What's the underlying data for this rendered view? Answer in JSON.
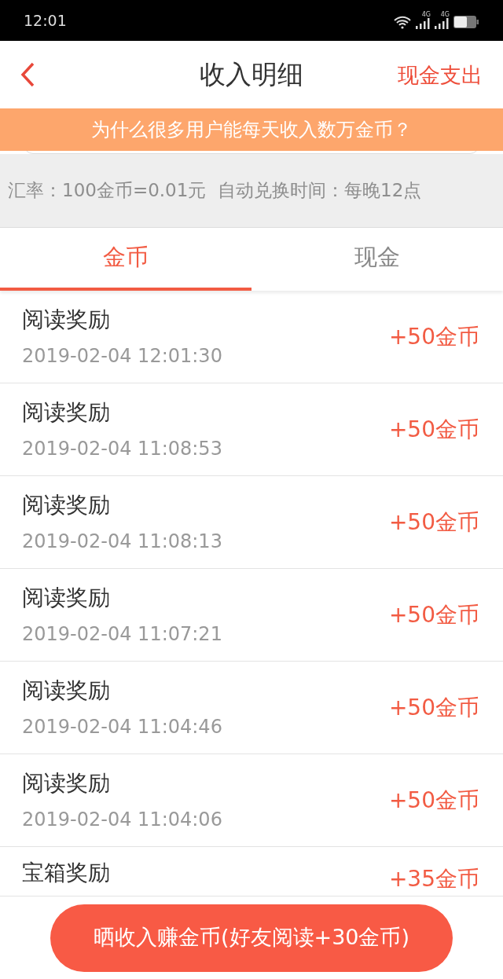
{
  "status_bar": {
    "time": "12:01",
    "network_labels": [
      "4G",
      "4G"
    ]
  },
  "header": {
    "title": "收入明细",
    "action": "现金支出"
  },
  "banner": {
    "text": "为什么很多用户能每天收入数万金币？"
  },
  "info": {
    "text": "汇率：100金币=0.01元  自动兑换时间：每晚12点"
  },
  "tabs": [
    {
      "label": "金币",
      "selected": true
    },
    {
      "label": "现金",
      "selected": false
    }
  ],
  "records": [
    {
      "title": "阅读奖励",
      "time": "2019-02-04 12:01:30",
      "amount": "+50金币"
    },
    {
      "title": "阅读奖励",
      "time": "2019-02-04 11:08:53",
      "amount": "+50金币"
    },
    {
      "title": "阅读奖励",
      "time": "2019-02-04 11:08:13",
      "amount": "+50金币"
    },
    {
      "title": "阅读奖励",
      "time": "2019-02-04 11:07:21",
      "amount": "+50金币"
    },
    {
      "title": "阅读奖励",
      "time": "2019-02-04 11:04:46",
      "amount": "+50金币"
    },
    {
      "title": "阅读奖励",
      "time": "2019-02-04 11:04:06",
      "amount": "+50金币"
    },
    {
      "title": "宝箱奖励",
      "amount": "+35金币"
    }
  ],
  "share_button": "晒收入赚金币(好友阅读+30金币)"
}
